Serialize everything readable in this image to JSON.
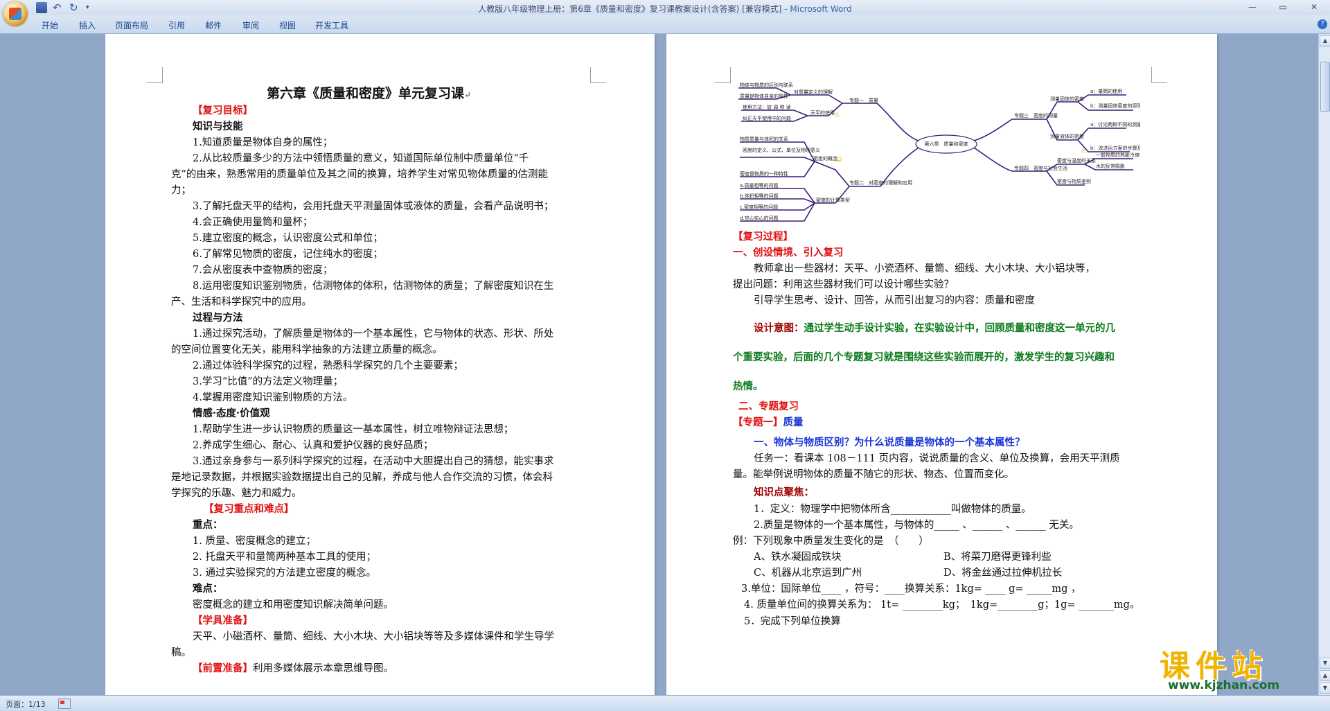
{
  "window": {
    "title_doc": "人教版八年级物理上册：第6章《质量和密度》复习课教案设计(含答案) [兼容模式]",
    "title_app": " - Microsoft Word",
    "minimize": "—",
    "restore": "▭",
    "close": "✕"
  },
  "quick_access": {
    "undo": "↶",
    "redo": "↻",
    "more": "▾"
  },
  "ribbon": {
    "tabs": [
      "开始",
      "插入",
      "页面布局",
      "引用",
      "邮件",
      "审阅",
      "视图",
      "开发工具"
    ],
    "help": "?"
  },
  "page1": {
    "title": "第六章《质量和密度》单元复习课",
    "goals_head": "【复习目标】",
    "k_head": "知识与技能",
    "k1": "1.知道质量是物体自身的属性；",
    "k2a": "2.从比较质量多少的方法中领悟质量的意义，知道国际单位制中质量单位“千",
    "k2b": "克”的由来，熟悉常用的质量单位及其之间的换算，培养学生对常见物体质量的估测能",
    "k2c": "力；",
    "k3": "3.了解托盘天平的结构，会用托盘天平测量固体或液体的质量，会看产品说明书；",
    "k4": "4.会正确使用量筒和量杯；",
    "k5": "5.建立密度的概念，认识密度公式和单位；",
    "k6": "6.了解常见物质的密度，记住纯水的密度；",
    "k7": "7.会从密度表中查物质的密度；",
    "k8a": "8.运用密度知识鉴别物质，估测物体的体积，估测物体的质量；了解密度知识在生",
    "k8b": "产、生活和科学探究中的应用。",
    "p_head": "过程与方法",
    "p1a": "1.通过探究活动，了解质量是物体的一个基本属性，它与物体的状态、形状、所处",
    "p1b": "的空间位置变化无关，能用科学抽象的方法建立质量的概念。",
    "p2": "2.通过体验科学探究的过程，熟悉科学探究的几个主要要素；",
    "p3": "3.学习“比值”的方法定义物理量；",
    "p4": "4.掌握用密度知识鉴别物质的方法。",
    "e_head": "情感·态度·价值观",
    "e1": "1.帮助学生进一步认识物质的质量这一基本属性，树立唯物辩证法思想；",
    "e2": "2.养成学生细心、耐心、认真和爱护仪器的良好品质；",
    "e3a": "3.通过亲身参与一系列科学探究的过程，在活动中大胆提出自己的猜想，能实事求",
    "e3b": "是地记录数据，并根据实验数据提出自己的见解，养成与他人合作交流的习惯，体会科",
    "e3c": "学探究的乐趣、魅力和威力。",
    "key_head": "【复习重点和难点】",
    "zd_head": "重点：",
    "zd1": "1. 质量、密度概念的建立；",
    "zd2": "2. 托盘天平和量筒两种基本工具的使用；",
    "zd3": "3. 通过实验探究的方法建立密度的概念。",
    "nd_head": "难点：",
    "nd1": "密度概念的建立和用密度知识解决简单问题。",
    "tools_head": "【学具准备】",
    "tools_a": "天平、小磁酒杯、量筒、细线、大小木块、大小铝块等等及多媒体课件和学生导学",
    "tools_b": "稿。",
    "pre_head": "【前置准备】",
    "pre_text": "利用多媒体展示本章思维导图。",
    "mark": "↵"
  },
  "mindmap": {
    "center": "第六章　质量和密度",
    "branch1": "专题一　质量",
    "b1_n1": "对质量定义的理解",
    "b1_n1_a": "物体与物质的区别与联系",
    "b1_n1_b": "质量是物体自身的属性",
    "b1_n2": "天平的使用",
    "b1_n2_a": "使用方法：放 调 称 读",
    "b1_n2_b": "纠正天平使用中的问题",
    "branch2": "专题二　对密度的理解和应用",
    "b2_n1": "密度的概念",
    "b2_n1_a": "物质质量与体积的关系",
    "b2_n1_b": "密度的定义、公式、单位及物理意义",
    "b2_n1_c": "密度是物质的一种特性",
    "b2_n2": "密度的计算类型",
    "b2_n2_a": "a.质量相等的问题",
    "b2_n2_b": "b.体积相等的问题",
    "b2_n2_c": "c.密度相等的问题",
    "b2_n2_d": "d.空心实心的问题",
    "branch3": "专题三　密度的测量",
    "b3_n1": "测量固体的密度",
    "b3_n1_a": "a：量筒的使用",
    "b3_n1_b": "b：测量固体密度的原理、器材、步骤、测量公式",
    "b3_n2": "测量液体的密度",
    "b3_n2_a": "a：讨论两种不同的测量方案",
    "b3_n2_b": "b：改进后方案的步骤及测量公式",
    "branch4": "专题四　密度与社会生活",
    "b4_n1": "密度与温度的关系",
    "b4_n1_a": "一般物质的热胀冷缩",
    "b4_n1_b": "水的反常膨胀",
    "b4_n2": "密度与物质鉴别"
  },
  "page2": {
    "process_head": "【复习过程】",
    "s1": "一、创设情境、引入复习",
    "s1_p1": "教师拿出一些器材：天平、小瓷酒杯、量筒、细线、大小木块、大小铝块等，",
    "s1_p2": "提出问题：利用这些器材我们可以设计哪些实验？",
    "s1_p3": "引导学生思考、设计、回答，从而引出复习的内容：质量和密度",
    "intent_label": "设计意图：",
    "intent_a": "通过学生动手设计实验，在实验设计中，回顾质量和密度这一单元的几",
    "intent_b": "个重要实验，后面的几个专题复习就是围绕这些实验而展开的，激发学生的复习兴趣和",
    "intent_c": "热情。",
    "s2": "二、专题复习",
    "topic1_label": "【专题一】",
    "topic1_text": "质量",
    "q1": "一、物体与物质区别？为什么说质量是物体的一个基本属性？",
    "task_a": "任务一：看课本 108－111 页内容，说说质量的含义、单位及换算，会用天平测质",
    "task_b": "量。能举例说明物体的质量不随它的形状、物态、位置而变化。",
    "focus": "知识点聚焦：",
    "f1": "1．定义：物理学中把物体所含____________叫做物体的质量。",
    "f2": "2.质量是物体的一个基本属性，与物体的_____ 、______ 、______ 无关。",
    "ex": "例：下列现象中质量发生变化的是　（　　）",
    "optA": "A、铁水凝固成铁块",
    "optB": "B、将菜刀磨得更锋利些",
    "optC": "C、机器从北京运到广州",
    "optD": "D、将金丝通过拉伸机拉长",
    "f3": "3.单位：国际单位____ ，符号：____换算关系：1kg= ____ g= _____mg ，",
    "f4": "4. 质量单位间的换算关系为： 1t= ________kg；　1kg=________g；1g= _______mg。",
    "f5": "5．完成下列单位换算"
  },
  "status": {
    "page": "页面：1/13"
  },
  "watermark": {
    "cn": "课件站",
    "url": "www.kjzhan.com"
  },
  "colors": {
    "red_heading": "#e01010",
    "blue_heading": "#1b36d6",
    "green_intent": "#0a7a1a",
    "mindmap_line": "#3c1a7a",
    "brand_yellow": "#f0b400"
  }
}
